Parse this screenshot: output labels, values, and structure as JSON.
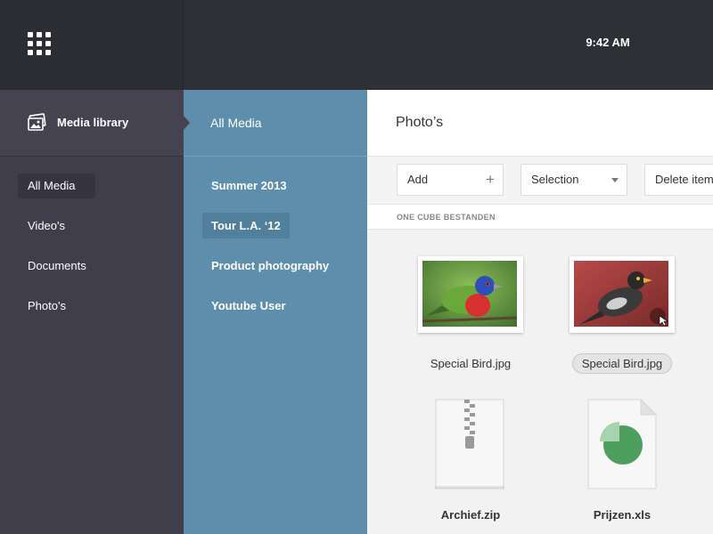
{
  "topbar": {
    "time": "9:42 AM"
  },
  "sidebar": {
    "title": "Media library",
    "items": [
      {
        "label": "All Media",
        "active": true
      },
      {
        "label": "Video's",
        "active": false
      },
      {
        "label": "Documents",
        "active": false
      },
      {
        "label": "Photo's",
        "active": false
      }
    ]
  },
  "middle": {
    "title": "All Media",
    "items": [
      {
        "label": "Summer 2013",
        "active": false
      },
      {
        "label": "Tour L.A. ‘12",
        "active": true
      },
      {
        "label": "Product photography",
        "active": false
      },
      {
        "label": "Youtube User",
        "active": false
      }
    ]
  },
  "main": {
    "title": "Photo’s",
    "toolbar": {
      "add_label": "Add",
      "selection_label": "Selection",
      "delete_label": "Delete items"
    },
    "section_label": "ONE CUBE BESTANDEN",
    "files": [
      {
        "name": "Special Bird.jpg",
        "type": "image",
        "selected": false
      },
      {
        "name": "Special Bird.jpg",
        "type": "image",
        "selected": true
      },
      {
        "name": "Archief.zip",
        "type": "zip",
        "selected": false
      },
      {
        "name": "Prijzen.xls",
        "type": "spreadsheet",
        "selected": false
      }
    ]
  },
  "colors": {
    "topbar": "#2e3036",
    "sidebar": "#403e4b",
    "middle": "#5e8eab",
    "spreadsheet_green": "#4e9e5e"
  }
}
